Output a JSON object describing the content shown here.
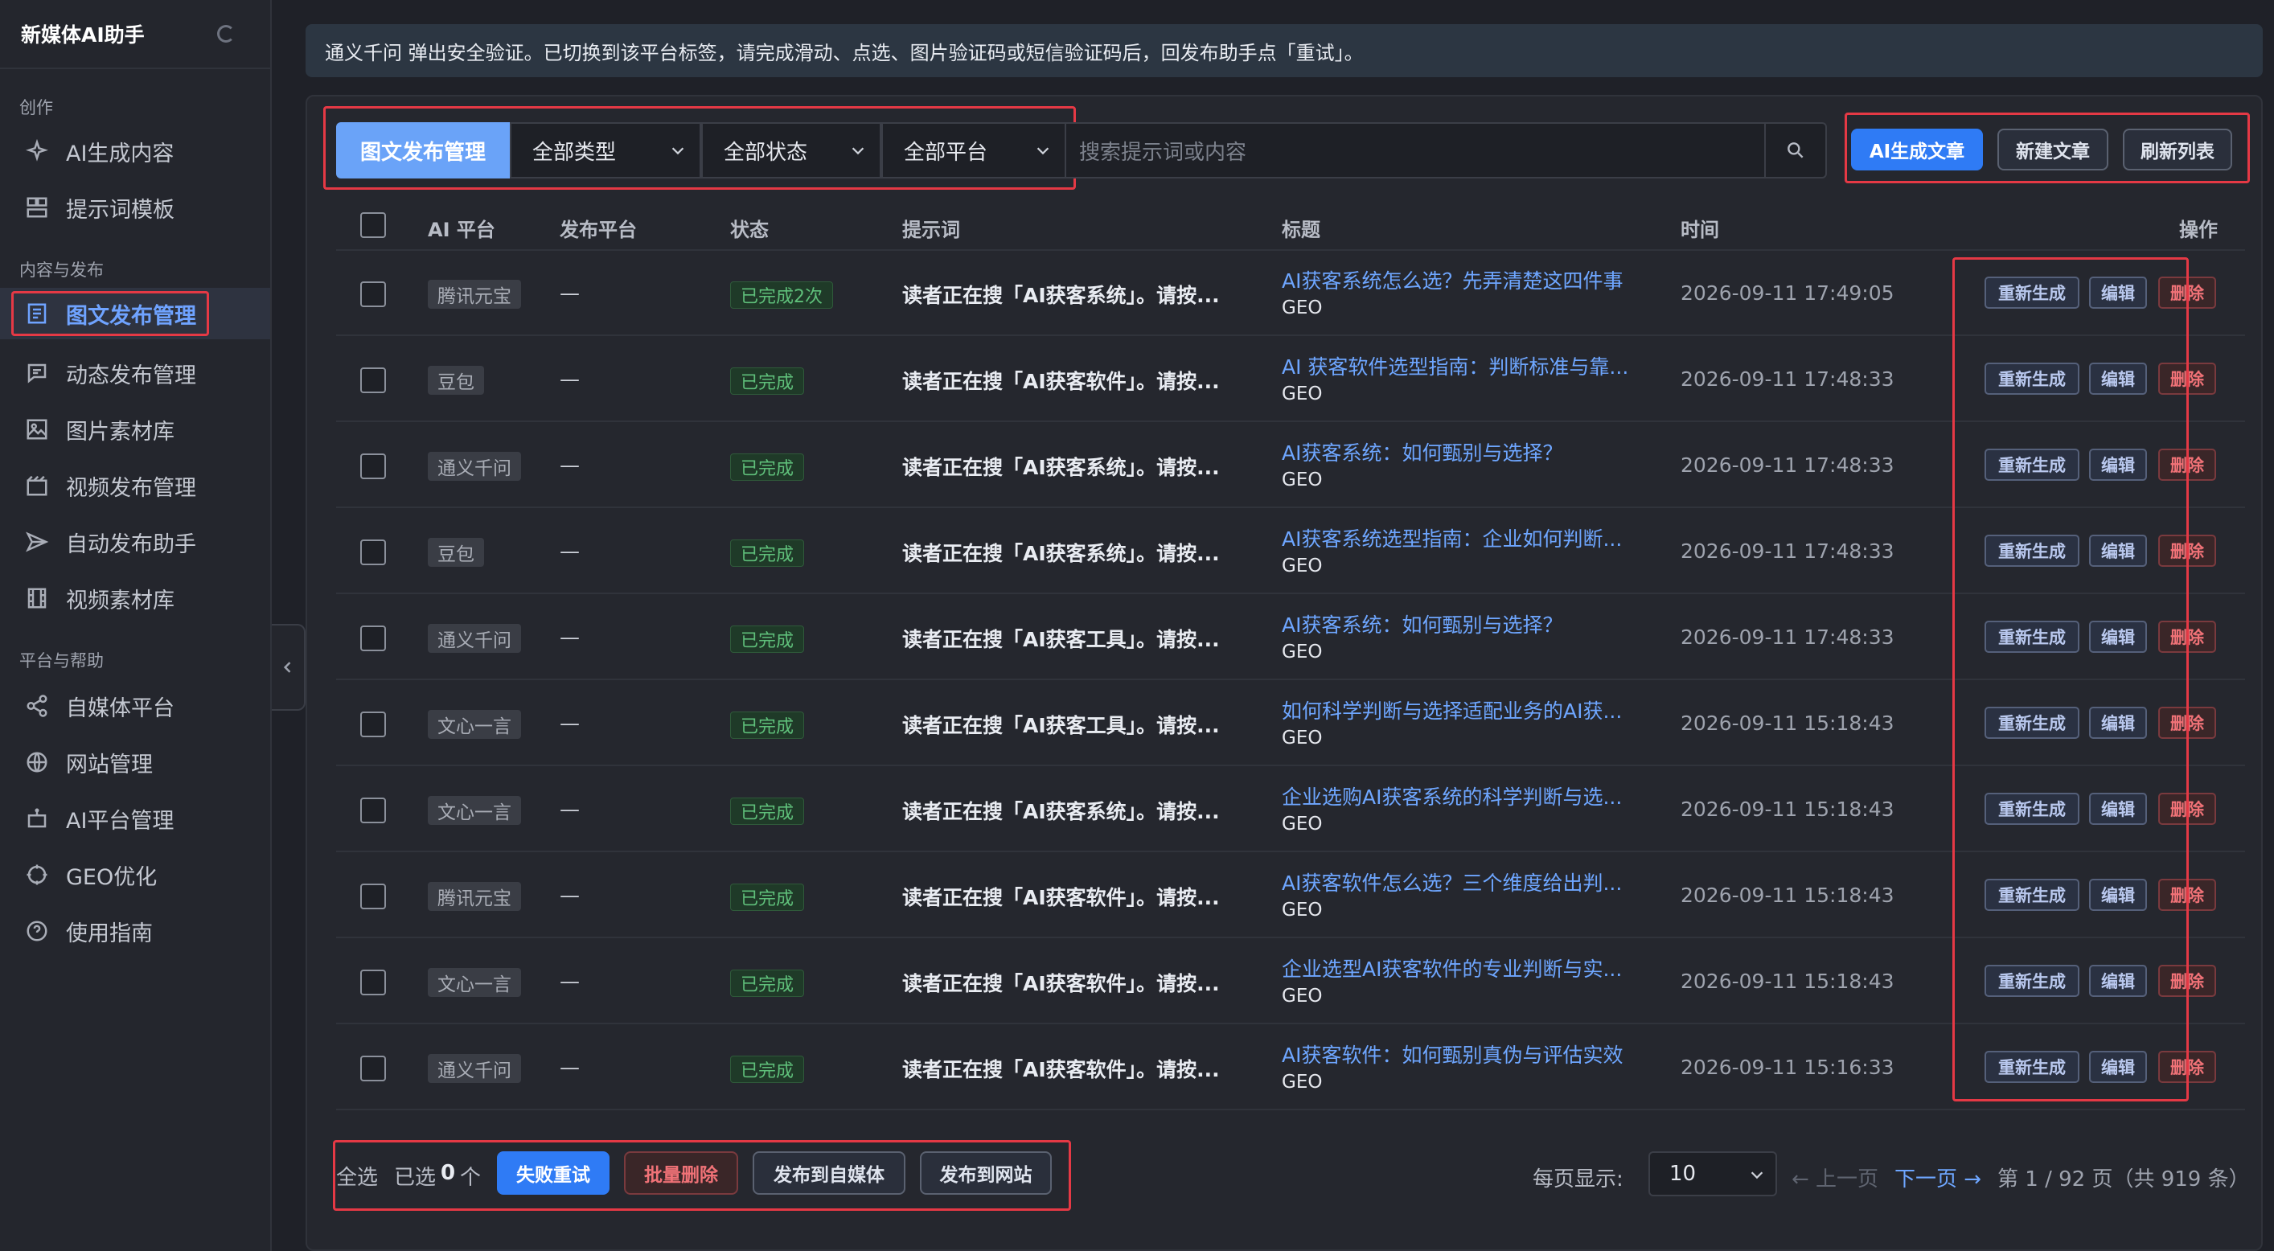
{
  "app": {
    "title": "新媒体AI助手"
  },
  "sidebar": {
    "sections": [
      {
        "label": "创作"
      },
      {
        "label": "内容与发布"
      },
      {
        "label": "平台与帮助"
      }
    ],
    "items": [
      {
        "label": "AI生成内容",
        "icon": "sparkle-icon"
      },
      {
        "label": "提示词模板",
        "icon": "template-icon"
      },
      {
        "label": "图文发布管理",
        "icon": "article-icon",
        "active": true
      },
      {
        "label": "动态发布管理",
        "icon": "chat-icon"
      },
      {
        "label": "图片素材库",
        "icon": "image-icon"
      },
      {
        "label": "视频发布管理",
        "icon": "video-icon"
      },
      {
        "label": "自动发布助手",
        "icon": "send-icon"
      },
      {
        "label": "视频素材库",
        "icon": "film-icon"
      },
      {
        "label": "自媒体平台",
        "icon": "share-icon"
      },
      {
        "label": "网站管理",
        "icon": "globe-icon"
      },
      {
        "label": "AI平台管理",
        "icon": "robot-icon"
      },
      {
        "label": "GEO优化",
        "icon": "target-icon"
      },
      {
        "label": "使用指南",
        "icon": "help-icon"
      }
    ]
  },
  "notice": "通义千问 弹出安全验证。已切换到该平台标签，请完成滑动、点选、图片验证码或短信验证码后，回发布助手点「重试」。",
  "toolbar": {
    "tab_label": "图文发布管理",
    "type_select": "全部类型",
    "status_select": "全部状态",
    "platform_select": "全部平台",
    "search_placeholder": "搜索提示词或内容",
    "ai_generate": "AI生成文章",
    "new_article": "新建文章",
    "refresh": "刷新列表"
  },
  "table": {
    "headers": {
      "ai_platform": "AI 平台",
      "publish_platform": "发布平台",
      "status": "状态",
      "prompt": "提示词",
      "title": "标题",
      "time": "时间",
      "actions": "操作"
    },
    "action_labels": {
      "regen": "重新生成",
      "edit": "编辑",
      "delete": "删除"
    },
    "rows": [
      {
        "ai": "腾讯元宝",
        "pub": "—",
        "status": "已完成2次",
        "prompt": "读者正在搜「AI获客系统」。请按...",
        "title": "AI获客系统怎么选？先弄清楚这四件事",
        "tag": "GEO",
        "time": "2026-09-11 17:49:05"
      },
      {
        "ai": "豆包",
        "pub": "—",
        "status": "已完成",
        "prompt": "读者正在搜「AI获客软件」。请按...",
        "title": "AI 获客软件选型指南：判断标准与靠...",
        "tag": "GEO",
        "time": "2026-09-11 17:48:33"
      },
      {
        "ai": "通义千问",
        "pub": "—",
        "status": "已完成",
        "prompt": "读者正在搜「AI获客系统」。请按...",
        "title": "AI获客系统：如何甄别与选择？",
        "tag": "GEO",
        "time": "2026-09-11 17:48:33"
      },
      {
        "ai": "豆包",
        "pub": "—",
        "status": "已完成",
        "prompt": "读者正在搜「AI获客系统」。请按...",
        "title": "AI获客系统选型指南：企业如何判断...",
        "tag": "GEO",
        "time": "2026-09-11 17:48:33"
      },
      {
        "ai": "通义千问",
        "pub": "—",
        "status": "已完成",
        "prompt": "读者正在搜「AI获客工具」。请按...",
        "title": "AI获客系统：如何甄别与选择？",
        "tag": "GEO",
        "time": "2026-09-11 17:48:33"
      },
      {
        "ai": "文心一言",
        "pub": "—",
        "status": "已完成",
        "prompt": "读者正在搜「AI获客工具」。请按...",
        "title": "如何科学判断与选择适配业务的AI获...",
        "tag": "GEO",
        "time": "2026-09-11 15:18:43"
      },
      {
        "ai": "文心一言",
        "pub": "—",
        "status": "已完成",
        "prompt": "读者正在搜「AI获客系统」。请按...",
        "title": "企业选购AI获客系统的科学判断与选...",
        "tag": "GEO",
        "time": "2026-09-11 15:18:43"
      },
      {
        "ai": "腾讯元宝",
        "pub": "—",
        "status": "已完成",
        "prompt": "读者正在搜「AI获客软件」。请按...",
        "title": "AI获客软件怎么选？三个维度给出判...",
        "tag": "GEO",
        "time": "2026-09-11 15:18:43"
      },
      {
        "ai": "文心一言",
        "pub": "—",
        "status": "已完成",
        "prompt": "读者正在搜「AI获客软件」。请按...",
        "title": "企业选型AI获客软件的专业判断与实...",
        "tag": "GEO",
        "time": "2026-09-11 15:18:43"
      },
      {
        "ai": "通义千问",
        "pub": "—",
        "status": "已完成",
        "prompt": "读者正在搜「AI获客软件」。请按...",
        "title": "AI获客软件：如何甄别真伪与评估实效",
        "tag": "GEO",
        "time": "2026-09-11 15:16:33"
      }
    ]
  },
  "footer": {
    "select_all": "全选",
    "selected_prefix": "已选",
    "selected_count": "0",
    "selected_suffix": "个",
    "retry_failed": "失败重试",
    "batch_delete": "批量删除",
    "publish_media": "发布到自媒体",
    "publish_site": "发布到网站",
    "per_page_label": "每页显示:",
    "per_page_value": "10",
    "prev": "← 上一页",
    "next": "下一页 →",
    "page_info": "第 1 / 92 页（共 919 条）"
  }
}
